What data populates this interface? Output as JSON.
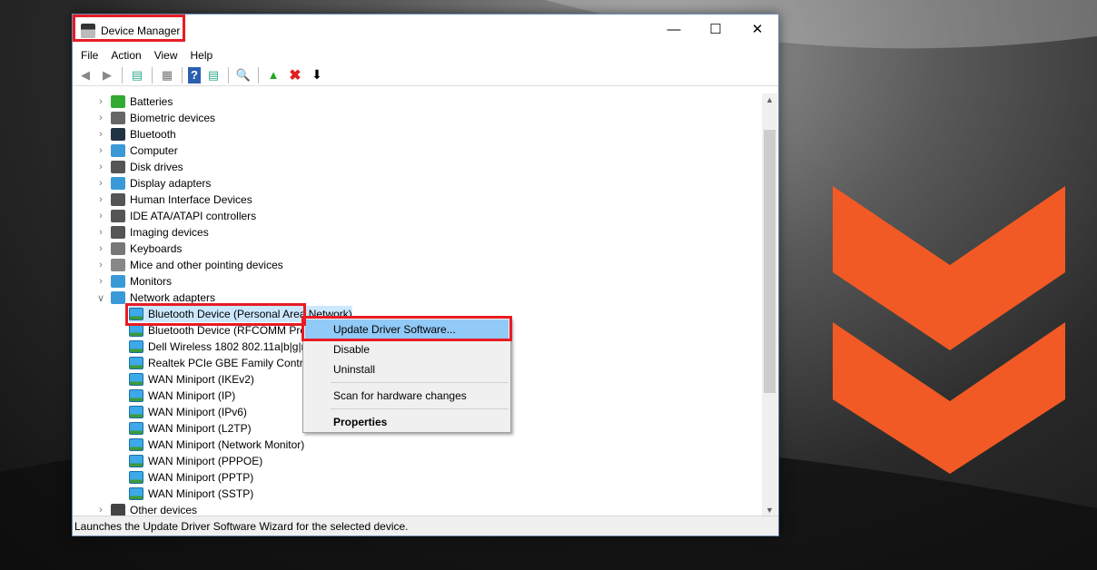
{
  "window": {
    "title": "Device Manager",
    "minimize_icon": "minimize-icon",
    "maximize_icon": "maximize-icon",
    "close_icon": "close-icon"
  },
  "menubar": [
    "File",
    "Action",
    "View",
    "Help"
  ],
  "toolbar": [
    "back-icon",
    "forward-icon",
    "show-hide-console-tree-icon",
    "properties-icon",
    "help-icon",
    "action-pane-icon",
    "scan-hardware-icon",
    "update-driver-icon",
    "uninstall-icon",
    "disable-icon"
  ],
  "tree": {
    "categories": [
      {
        "label": "Batteries",
        "expanded": false
      },
      {
        "label": "Biometric devices",
        "expanded": false
      },
      {
        "label": "Bluetooth",
        "expanded": false
      },
      {
        "label": "Computer",
        "expanded": false
      },
      {
        "label": "Disk drives",
        "expanded": false
      },
      {
        "label": "Display adapters",
        "expanded": false
      },
      {
        "label": "Human Interface Devices",
        "expanded": false
      },
      {
        "label": "IDE ATA/ATAPI controllers",
        "expanded": false
      },
      {
        "label": "Imaging devices",
        "expanded": false
      },
      {
        "label": "Keyboards",
        "expanded": false
      },
      {
        "label": "Mice and other pointing devices",
        "expanded": false
      },
      {
        "label": "Monitors",
        "expanded": false
      },
      {
        "label": "Network adapters",
        "expanded": true
      }
    ],
    "network_children": [
      "Bluetooth Device (Personal Area Network)",
      "Bluetooth Device (RFCOMM Protocol TDI)",
      "Dell Wireless 1802 802.11a|b|g|n Adapter",
      "Realtek PCIe GBE Family Controller",
      "WAN Miniport (IKEv2)",
      "WAN Miniport (IP)",
      "WAN Miniport (IPv6)",
      "WAN Miniport (L2TP)",
      "WAN Miniport (Network Monitor)",
      "WAN Miniport (PPPOE)",
      "WAN Miniport (PPTP)",
      "WAN Miniport (SSTP)"
    ],
    "selected": "Bluetooth Device (Personal Area Network)",
    "after": "Other devices"
  },
  "context_menu": {
    "items": [
      "Update Driver Software...",
      "Disable",
      "Uninstall",
      "Scan for hardware changes",
      "Properties"
    ],
    "highlighted": "Update Driver Software..."
  },
  "status": "Launches the Update Driver Software Wizard for the selected device.",
  "colors": {
    "highlight_box": "#e81c24",
    "brand_chevron": "#f15a24",
    "selection": "#cce8ff",
    "menu_hover": "#91c9f7"
  }
}
